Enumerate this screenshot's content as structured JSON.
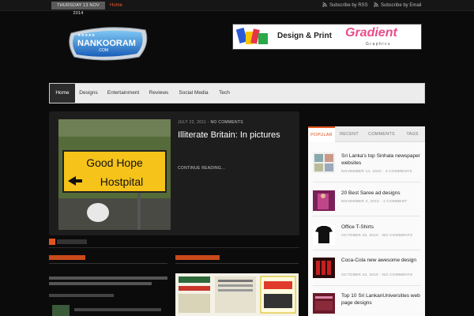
{
  "topbar": {
    "date": "THURSDAY 13 NOV 2014",
    "home_link": "Home",
    "subscribe_rss": "Subscribe by RSS",
    "subscribe_email": "Subscribe by Email"
  },
  "logo": {
    "text": "NANKOORAM",
    "sub": ".COM"
  },
  "banner": {
    "text": "Design & Print",
    "brand": "Gradient",
    "sub": "Graphics"
  },
  "nav": {
    "items": [
      "Home",
      "Designs",
      "Entertainment",
      "Reviews",
      "Social Media",
      "Tech"
    ]
  },
  "featured": {
    "date": "JULY 22, 2011",
    "sep": " - ",
    "comments": "NO COMMENTS",
    "title": "Illiterate Britain: In pictures",
    "more": "CONTINUE READING...",
    "sign_line1": "Good Hope",
    "sign_line2": "Hostpital"
  },
  "sidebar": {
    "tabs": [
      "POPULAR",
      "RECENT",
      "COMMENTS",
      "TAGS"
    ],
    "items": [
      {
        "title": "Sri Lanka's top Sinhala newspaper websites",
        "date": "NOVEMBER 14, 2010",
        "comments": "4 COMMENTS"
      },
      {
        "title": "20 Best Saree ad designs",
        "date": "NOVEMBER 2, 2010",
        "comments": "1 COMMENT"
      },
      {
        "title": "Office T-Shirts",
        "date": "OCTOBER 22, 2010",
        "comments": "NO COMMENTS"
      },
      {
        "title": "Coca-Cola new awesome design",
        "date": "OCTOBER 23, 2010",
        "comments": "NO COMMENTS"
      },
      {
        "title": "Top 10 Sri LankanUniversities web page designs",
        "date": "",
        "comments": ""
      }
    ]
  },
  "colors": {
    "accent": "#e0541f",
    "nav_bg": "#ececec",
    "page_bg": "#0b0b0b"
  }
}
